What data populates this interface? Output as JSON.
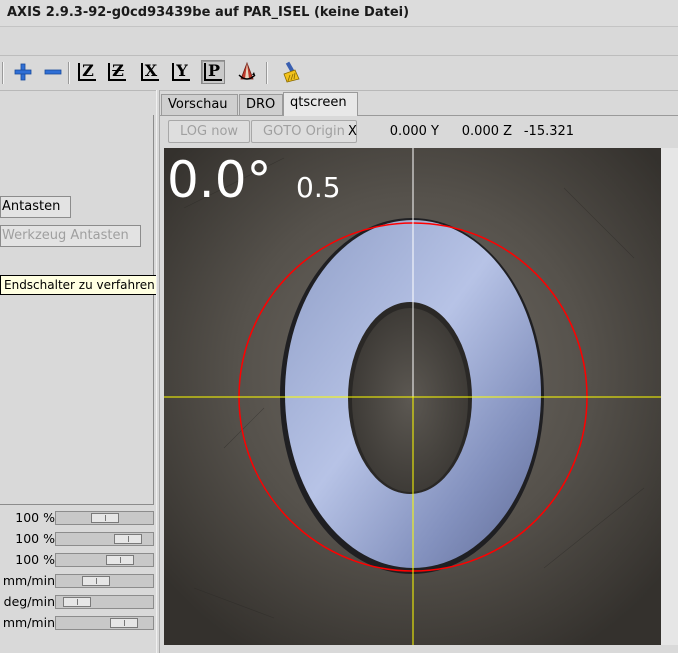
{
  "window": {
    "title": "AXIS 2.9.3-92-g0cd93439be auf PAR_ISEL (keine Datei)"
  },
  "toolbar": {
    "items": [
      {
        "icon": "zoom-in-icon"
      },
      {
        "icon": "zoom-out-icon"
      },
      {
        "icon": "view-z-icon",
        "label": "Z"
      },
      {
        "icon": "view-z2-icon",
        "label": "Z"
      },
      {
        "icon": "view-x-icon",
        "label": "X"
      },
      {
        "icon": "view-y-icon",
        "label": "Y"
      },
      {
        "icon": "view-p-icon",
        "label": "P"
      },
      {
        "icon": "rotate-view-icon"
      },
      {
        "icon": "clear-plot-icon"
      }
    ]
  },
  "left_panel": {
    "touch_off_button": "Antasten",
    "tool_touch_off_button": "Werkzeug Antasten",
    "tooltip": "Endschalter zu verfahren [L]",
    "overrides": [
      {
        "label": "100 %",
        "level": 0.5
      },
      {
        "label": "100 %",
        "level": 0.84
      },
      {
        "label": "100 %",
        "level": 0.72
      },
      {
        "label": "mm/min",
        "level": 0.38
      },
      {
        "label": "deg/min",
        "level": 0.1
      },
      {
        "label": "mm/min",
        "level": 0.78
      }
    ]
  },
  "tabs": [
    {
      "label": "Vorschau",
      "active": false
    },
    {
      "label": "DRO",
      "active": false
    },
    {
      "label": "qtscreen",
      "active": true
    }
  ],
  "qtscreen": {
    "log_button": "LOG now",
    "goto_button": "GOTO Origin",
    "dro": {
      "x_label": "X",
      "x_value": "0.000",
      "y_label": "Y",
      "y_value": "0.000",
      "z_label": "Z",
      "z_value": "-15.321"
    },
    "camera": {
      "angle": "0.0°",
      "scale": "0.5",
      "crosshair_vertical_color": "#ffffff",
      "crosshair_horizontal_color": "#ffff00",
      "circle_color": "#ff0000"
    }
  }
}
